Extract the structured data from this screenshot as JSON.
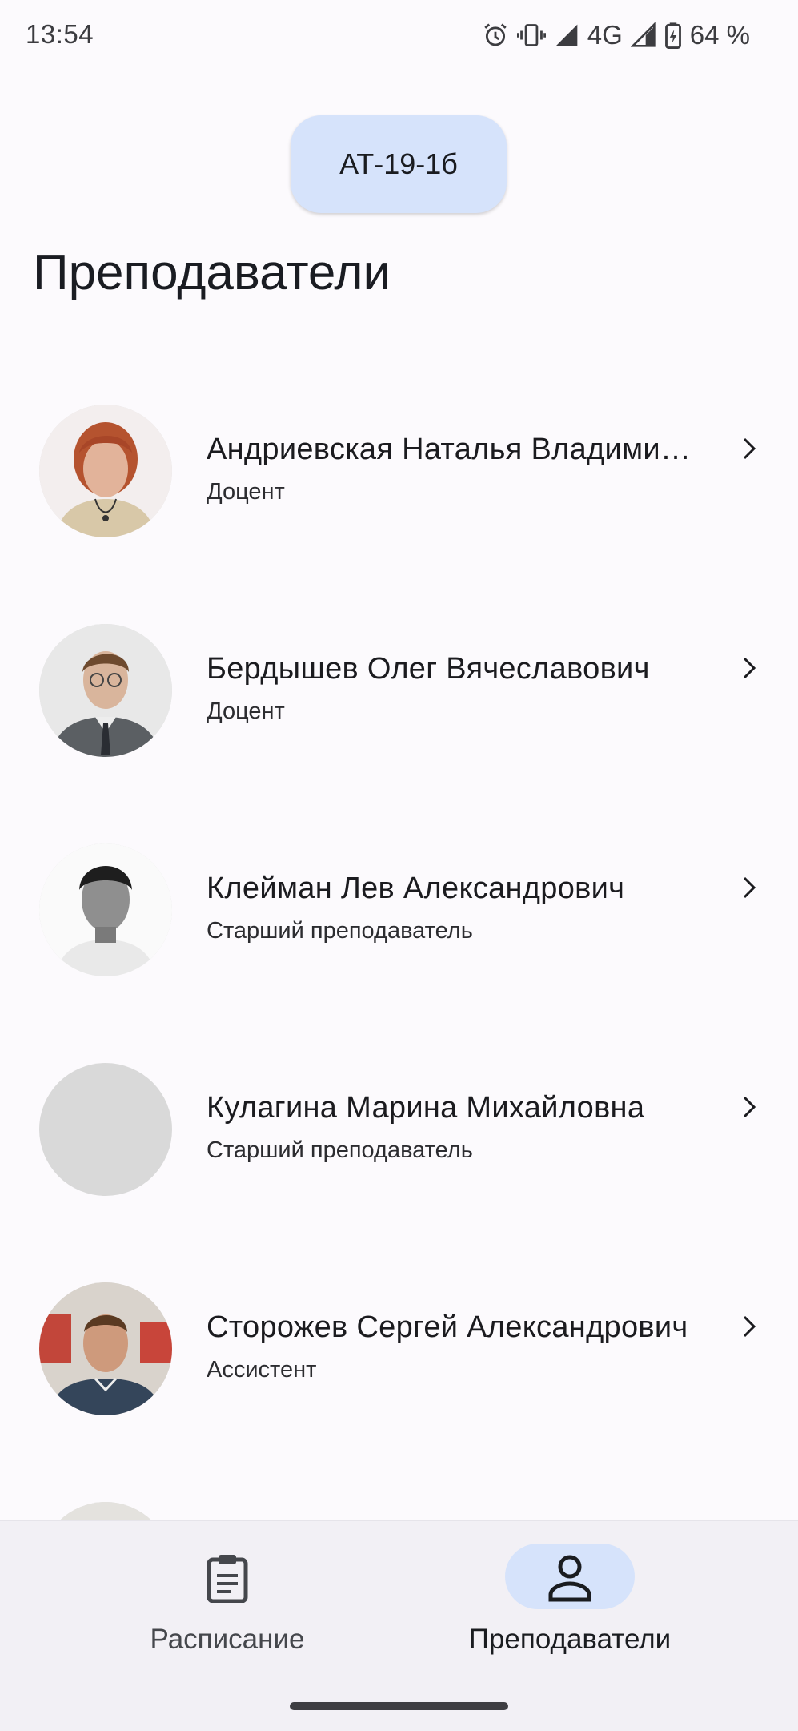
{
  "status_bar": {
    "time": "13:54",
    "network": "4G",
    "battery": "64 %",
    "icons": [
      "alarm-icon",
      "vibrate-icon",
      "signal-icon",
      "signal-icon",
      "battery-charging-icon"
    ]
  },
  "group": {
    "label": "АТ-19-1б"
  },
  "page": {
    "title": "Преподаватели"
  },
  "teachers": [
    {
      "name": "Андриевская Наталья Владимировна",
      "role": "Доцент",
      "avatar": "photo"
    },
    {
      "name": "Бердышев Олег Вячеславович",
      "role": "Доцент",
      "avatar": "photo"
    },
    {
      "name": "Клейман Лев Александрович",
      "role": "Старший преподаватель",
      "avatar": "photo-grayscale"
    },
    {
      "name": "Кулагина Марина Михайловна",
      "role": "Старший преподаватель",
      "avatar": "placeholder"
    },
    {
      "name": "Сторожев Сергей Александрович",
      "role": "Ассистент",
      "avatar": "photo"
    },
    {
      "name": "",
      "role": "",
      "avatar": "photo"
    }
  ],
  "bottom_nav": {
    "items": [
      {
        "label": "Расписание",
        "icon": "clipboard-icon",
        "active": false
      },
      {
        "label": "Преподаватели",
        "icon": "person-icon",
        "active": true
      }
    ]
  },
  "colors": {
    "background": "#FCFAFD",
    "accent_container": "#D6E3FB",
    "nav_background": "#F2F0F5"
  }
}
